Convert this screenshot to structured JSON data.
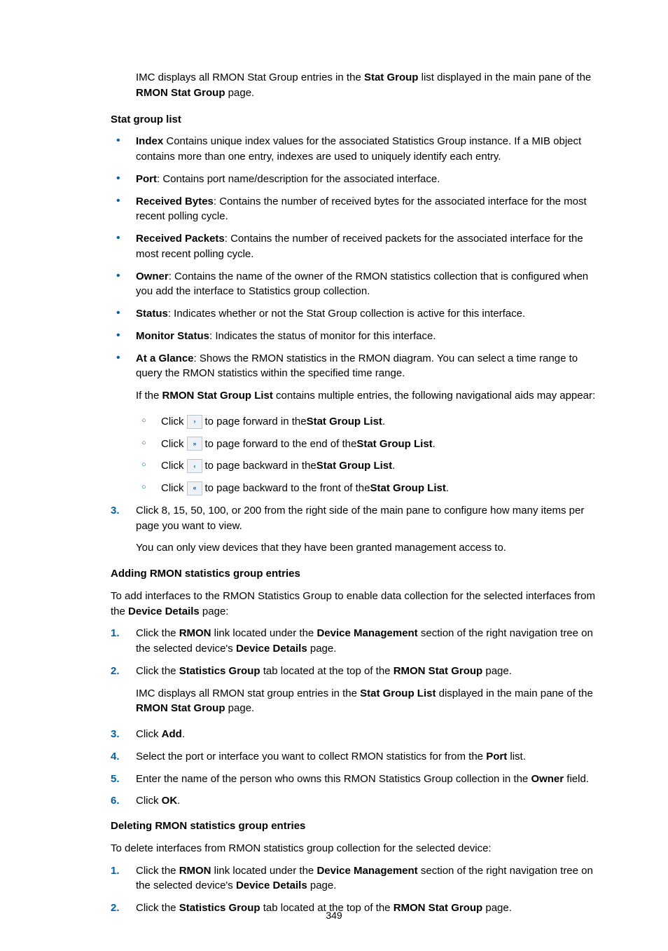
{
  "pageNumber": "349",
  "introA": "IMC displays all RMON Stat Group entries in the ",
  "introB": "Stat Group",
  "introC": " list displayed in the main pane of the ",
  "introD": "RMON Stat Group",
  "introE": " page.",
  "h1": "Stat group list",
  "bullets": [
    {
      "b": "Index",
      "t": " Contains unique index values for the associated Statistics Group instance. If a MIB object contains more than one entry, indexes are used to uniquely identify each entry."
    },
    {
      "b": "Port",
      "t": ": Contains port name/description for the associated interface."
    },
    {
      "b": "Received Bytes",
      "t": ": Contains the number of received bytes for the associated interface for the most recent polling cycle."
    },
    {
      "b": "Received Packets",
      "t": ": Contains the number of received packets for the associated interface for the most recent polling cycle."
    },
    {
      "b": "Owner",
      "t": ": Contains the name of the owner of the RMON statistics collection that is configured when you add the interface to Statistics group collection."
    },
    {
      "b": "Status",
      "t": ": Indicates whether or not the Stat Group collection is active for this interface."
    },
    {
      "b": "Monitor Status",
      "t": ": Indicates the status of monitor for this interface."
    },
    {
      "b": "At a Glance",
      "t": ": Shows the RMON statistics in the RMON diagram. You can select a time range to query the RMON statistics within the specified time range."
    }
  ],
  "afterGlanceA": "If the ",
  "afterGlanceB": "RMON Stat Group List",
  "afterGlanceC": " contains multiple entries, the following navigational aids may appear:",
  "circles": [
    {
      "pre": "Click ",
      "icon": "›",
      "postA": " to page forward in the ",
      "bold": "Stat Group List",
      "postB": "."
    },
    {
      "pre": "Click ",
      "icon": "»",
      "postA": " to page forward to the end of the ",
      "bold": "Stat Group List",
      "postB": "."
    },
    {
      "pre": "Click ",
      "icon": "‹",
      "postA": " to page backward in the ",
      "bold": "Stat Group List",
      "postB": "."
    },
    {
      "pre": "Click ",
      "icon": "«",
      "postA": " to page backward to the front of the ",
      "bold": "Stat Group List",
      "postB": "."
    }
  ],
  "step3a": "Click 8, 15, 50, 100, or 200 from the right side of the main pane to configure how many items per page you want to view.",
  "step3b": "You can only view devices that they have been granted management access to.",
  "h2": "Adding RMON statistics group entries",
  "add_introA": "To add interfaces to the RMON Statistics Group to enable data collection for the selected interfaces from the ",
  "add_introB": "Device Details",
  "add_introC": " page:",
  "addSteps": {
    "s1a": "Click the ",
    "s1b": "RMON",
    "s1c": " link located under the ",
    "s1d": "Device Management",
    "s1e": " section of the right navigation tree on the selected device's ",
    "s1f": "Device Details",
    "s1g": " page.",
    "s2a": "Click the ",
    "s2b": "Statistics Group",
    "s2c": " tab located at the top of the ",
    "s2d": "RMON Stat Group",
    "s2e": " page.",
    "s2fA": "IMC displays all RMON stat group entries in the ",
    "s2fB": "Stat Group List",
    "s2fC": " displayed in the main pane of the ",
    "s2fD": "RMON Stat Group",
    "s2fE": " page.",
    "s3a": "Click ",
    "s3b": "Add",
    "s3c": ".",
    "s4a": "Select the port or interface you want to collect RMON statistics for from the ",
    "s4b": "Port",
    "s4c": " list.",
    "s5a": "Enter the name of the person who owns this RMON Statistics Group collection in the ",
    "s5b": "Owner",
    "s5c": " field.",
    "s6a": "Click ",
    "s6b": "OK",
    "s6c": "."
  },
  "h3": "Deleting RMON statistics group entries",
  "del_intro": "To delete interfaces from RMON statistics group collection for the selected device:",
  "delSteps": {
    "s1a": "Click the ",
    "s1b": "RMON",
    "s1c": " link located under the ",
    "s1d": "Device Management",
    "s1e": " section of the right navigation tree on the selected device's ",
    "s1f": "Device Details",
    "s1g": " page.",
    "s2a": "Click the ",
    "s2b": "Statistics Group",
    "s2c": " tab located at the top of the ",
    "s2d": "RMON Stat Group",
    "s2e": " page."
  }
}
